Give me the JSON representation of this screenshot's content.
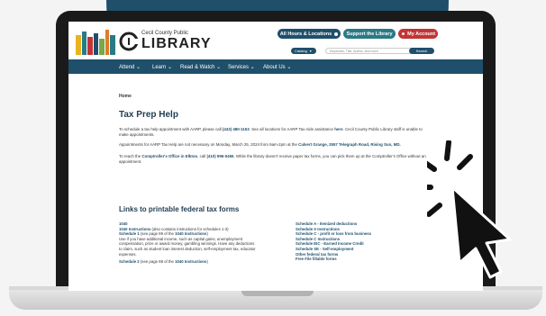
{
  "header": {
    "logo_sub": "Cecil County Public",
    "logo_main": "LIBRARY",
    "btn_hours": "All Hours & Locations",
    "btn_support": "Support the Library",
    "btn_account": "My Account",
    "catalog": "Catalog",
    "search_placeholder": "Keywords, Title, Author, and more",
    "search_btn": "Search"
  },
  "nav": [
    "Attend",
    "Learn",
    "Read & Watch",
    "Services",
    "About Us"
  ],
  "breadcrumb": "Home",
  "title": "Tax Prep Help",
  "intro": {
    "p1a": "To schedule a tax help appointment with AARP, please call ",
    "p1b": "(443) 480-1153",
    "p1c": ". See all locations for AARP Tax Aide assistance ",
    "p1d": "here",
    "p1e": ". Cecil County Public Library staff is unable to make appointments.",
    "p2a": "Appointments for AARP Tax Help are not necessary on Monday, March 25, 2024 from 9am-2pm at the ",
    "p2b": "Calvert Grange, 2557 Telegraph Road, Rising Sun, MD.",
    "p3a": "To reach the ",
    "p3b": "Comptroller's Office in Elkton",
    "p3c": ", call ",
    "p3d": "(410) 996-0465",
    "p3e": ". While the library doesn't receive paper tax forms, you can pick them up at the Comptroller's Office without an appointment."
  },
  "links_heading": "Links to printable federal tax forms",
  "left_col": {
    "l1": "1040",
    "l2": "1040 Instructions",
    "l2b": " (also contains instructions for schedules 1-3)",
    "l3": "Schedule 1",
    "l3b": " (see page 99 of the ",
    "l3c": "1040 Instructions",
    "l3d": ")",
    "l4": "Use if you have additional income, such as capital gains, unemployment",
    "l5": "compensation, prize or award money, gambling winnings. Have any deductions",
    "l6": "to claim, such as student loan interest deduction, self-employment tax, educator",
    "l7": "expenses.",
    "l8": "Schedule 2",
    "l8b": " (see page 98 of the ",
    "l8c": "1040 Instructions",
    "l8d": ")"
  },
  "right_col": [
    "Schedule A - Itemized deductions",
    "Schedule A Instructions",
    "Schedule C - profit or loss from business",
    "Schedule C Instructions",
    "Schedule EIC - Earned Income Credit",
    "Schedule SE - Self-employment",
    "Other federal tax forms",
    "Free File fillable forms"
  ],
  "colors": {
    "navy": "#1f4f6b",
    "support": "#2a7a86",
    "account": "#c23535"
  }
}
